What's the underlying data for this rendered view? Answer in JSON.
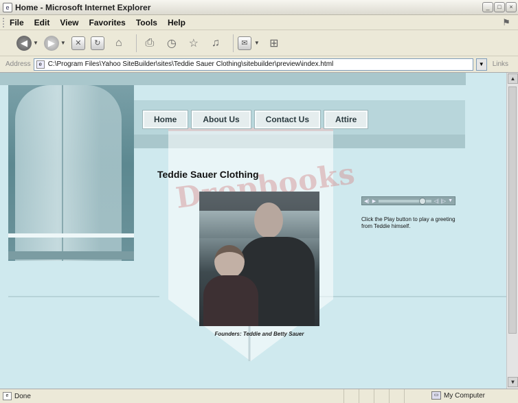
{
  "window": {
    "title": "Home - Microsoft Internet Explorer",
    "app_icon": "ie-page-icon",
    "controls": [
      "minimize",
      "maximize",
      "close"
    ]
  },
  "menu": {
    "items": [
      {
        "label": "File"
      },
      {
        "label": "Edit"
      },
      {
        "label": "View"
      },
      {
        "label": "Favorites"
      },
      {
        "label": "Tools"
      },
      {
        "label": "Help"
      }
    ]
  },
  "toolbar": {
    "icons": [
      "back-icon",
      "forward-icon",
      "stop-icon",
      "refresh-icon",
      "home-icon",
      "print-icon",
      "history-icon",
      "favorites-icon",
      "media-icon",
      "mail-icon",
      "network-icon"
    ]
  },
  "address": {
    "label": "Address",
    "url": "C:\\Program Files\\Yahoo SiteBuilder\\sites\\Teddie Sauer Clothing\\sitebuilder\\preview\\index.html",
    "links_label": "Links"
  },
  "page": {
    "nav": [
      {
        "label": "Home"
      },
      {
        "label": "About Us"
      },
      {
        "label": "Contact Us"
      },
      {
        "label": "Attire"
      }
    ],
    "site_title": "Teddie Sauer Clothing",
    "photo_caption": "Founders: Teddie and Betty Sauer",
    "player_note": "Click the Play button to play a greeting from Teddie himself.",
    "watermark": "Dropbooks"
  },
  "status": {
    "text": "Done",
    "zone": "My Computer"
  },
  "colors": {
    "page_bg": "#cfe9ee",
    "band": "#a9c7cc",
    "nav_button_bg": "#e5edee",
    "chrome": "#ece9d8"
  }
}
